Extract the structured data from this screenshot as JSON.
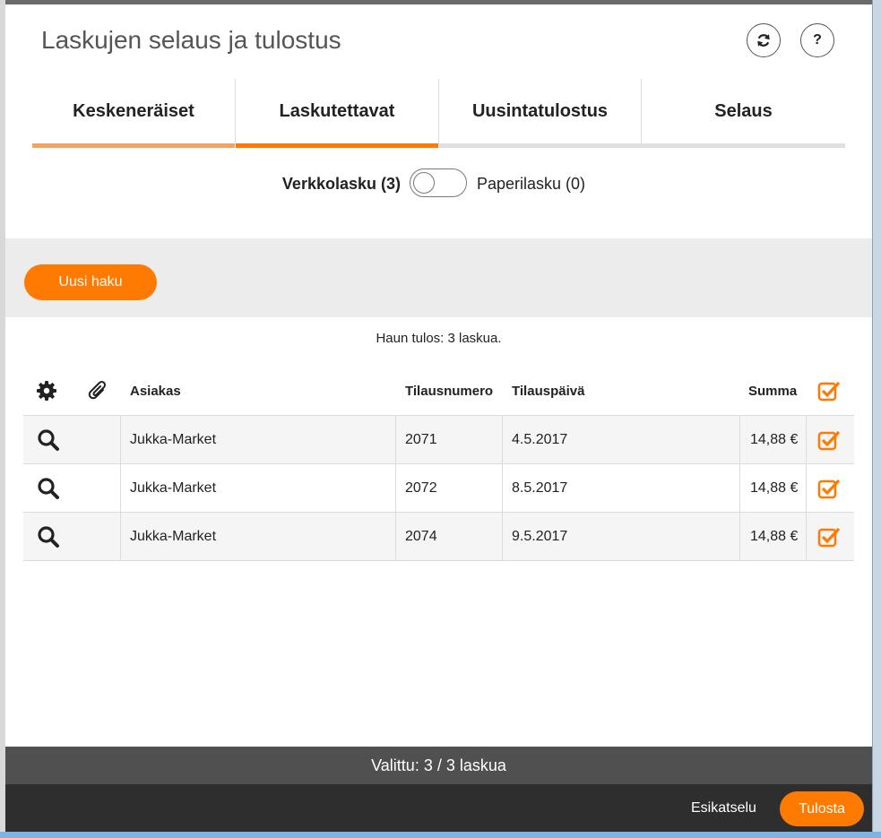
{
  "dialog": {
    "title": "Laskujen selaus ja tulostus",
    "help_label": "?"
  },
  "tabs": [
    {
      "label": "Keskeneräiset"
    },
    {
      "label": "Laskutettavat"
    },
    {
      "label": "Uusintatulostus"
    },
    {
      "label": "Selaus"
    }
  ],
  "toggle": {
    "left_label": "Verkkolasku (3)",
    "right_label": "Paperilasku (0)",
    "state": "off"
  },
  "search": {
    "new_search_label": "Uusi haku"
  },
  "result": {
    "text": "Haun tulos: 3 laskua."
  },
  "table": {
    "headers": {
      "customer": "Asiakas",
      "order_number": "Tilausnumero",
      "order_date": "Tilauspäivä",
      "sum": "Summa"
    },
    "rows": [
      {
        "customer": "Jukka-Market",
        "order_number": "2071",
        "order_date": "4.5.2017",
        "sum": "14,88 €",
        "checked": true
      },
      {
        "customer": "Jukka-Market",
        "order_number": "2072",
        "order_date": "8.5.2017",
        "sum": "14,88 €",
        "checked": true
      },
      {
        "customer": "Jukka-Market",
        "order_number": "2074",
        "order_date": "9.5.2017",
        "sum": "14,88 €",
        "checked": true
      }
    ]
  },
  "status": {
    "selected_text": "Valittu: 3 / 3 laskua"
  },
  "footer": {
    "preview_label": "Esikatselu",
    "print_label": "Tulosta"
  },
  "colors": {
    "accent": "#ff7a00",
    "tab_inactive_underline": "#f4a460",
    "band": "#ececec",
    "status_bar": "#505050",
    "footer": "#2e2e2e"
  },
  "icons": {
    "refresh": "refresh-icon",
    "help": "help-icon",
    "settings": "gear-icon",
    "attachment": "paperclip-icon",
    "row_view": "search-icon",
    "checkbox": "checkbox-checked-icon"
  }
}
